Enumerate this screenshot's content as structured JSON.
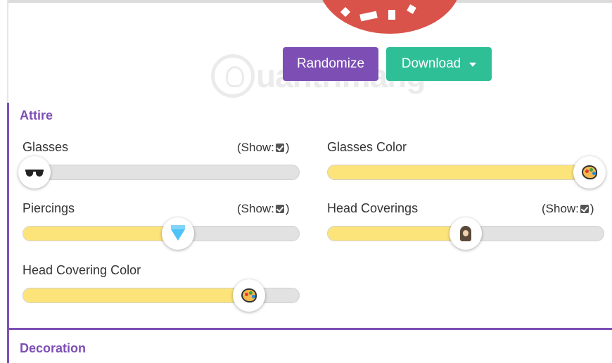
{
  "toolbar": {
    "randomize_label": "Randomize",
    "download_label": "Download"
  },
  "watermark": {
    "text": "uantrimang"
  },
  "sections": {
    "attire": {
      "title": "Attire"
    },
    "decoration": {
      "title": "Decoration"
    }
  },
  "sliders": {
    "glasses": {
      "label": "Glasses",
      "show": "(Show:",
      "show_close": ")",
      "checked": true,
      "value": 0.04
    },
    "glasses_color": {
      "label": "Glasses Color",
      "value": 0.95
    },
    "piercings": {
      "label": "Piercings",
      "show": "(Show:",
      "show_close": ")",
      "checked": true,
      "value": 0.56
    },
    "head_coverings": {
      "label": "Head Coverings",
      "show": "(Show:",
      "show_close": ")",
      "checked": true,
      "value": 0.5
    },
    "head_covering_color": {
      "label": "Head Covering Color",
      "value": 0.82
    }
  },
  "colors": {
    "accent": "#7d4fb5",
    "download": "#2fbf97",
    "fill": "#fde47a",
    "track": "#e2e2e2",
    "avatar_red": "#d9534a"
  }
}
